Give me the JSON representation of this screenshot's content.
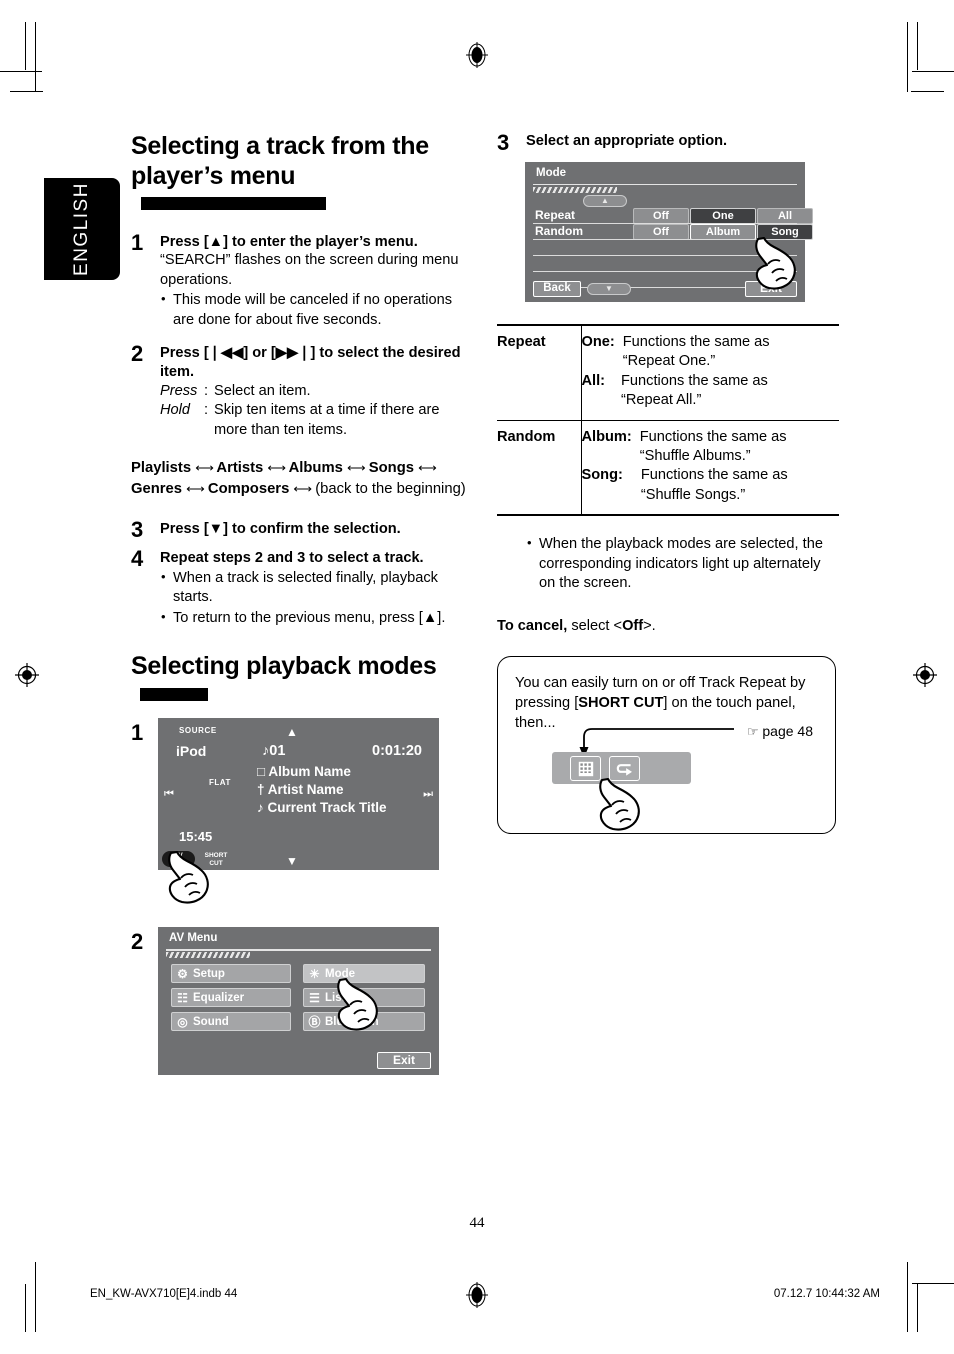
{
  "language_tab": "ENGLISH",
  "left_column": {
    "heading": "Selecting a track from the player’s menu",
    "steps": [
      {
        "num": "1",
        "lead": "Press [▲] to enter the player’s menu.",
        "body": "“SEARCH” flashes on the screen during menu operations.",
        "bullets": [
          "This mode will be canceled if no operations are done for about five seconds."
        ]
      },
      {
        "num": "2",
        "lead": "Press [❘◀◀] or [▶▶❘] to select the desired item.",
        "press_key": "Press",
        "press_val": "Select an item.",
        "hold_key": "Hold",
        "hold_val": "Skip ten items at a time if there are more than ten items."
      },
      {
        "num": "3",
        "lead": "Press [▼] to confirm the selection."
      },
      {
        "num": "4",
        "lead": "Repeat steps 2 and 3 to select a track.",
        "bullets": [
          "When a track is selected finally, playback starts.",
          "To return to the previous menu, press [▲]."
        ]
      }
    ],
    "chain": {
      "items": [
        "Playlists",
        "Artists",
        "Albums",
        "Songs",
        "Genres",
        "Composers"
      ],
      "tail": "(back to the beginning)",
      "arrow": "⟷"
    },
    "heading2": "Selecting playback modes",
    "step1_num": "1",
    "step2_num": "2"
  },
  "ipod_screen": {
    "source_label": "SOURCE",
    "source_name": "iPod",
    "track": "♪01",
    "time": "0:01:20",
    "album": "Album Name",
    "artist": "Artist Name",
    "title": "Current Track Title",
    "album_icon": "□",
    "artist_icon": "†",
    "title_icon": "♪",
    "flat": "FLAT",
    "prev_icon": "⏮",
    "next_icon": "⏭",
    "clock": "15:45",
    "up_arrow": "▲",
    "down_arrow": "▼",
    "av_menu_line1": "AV",
    "av_menu_line2": "MENU",
    "shortcut_line1": "SHORT",
    "shortcut_line2": "CUT"
  },
  "av_menu_screen": {
    "title": "AV Menu",
    "left_items": [
      {
        "label": "Setup",
        "icon": "⚙"
      },
      {
        "label": "Equalizer",
        "icon": "☷"
      },
      {
        "label": "Sound",
        "icon": "◎"
      }
    ],
    "right_items": [
      {
        "label": "Mode",
        "icon": "☀"
      },
      {
        "label": "List",
        "icon": "☰"
      },
      {
        "label": "Bluetooth",
        "icon": "Ⓑ"
      }
    ],
    "exit": "Exit"
  },
  "right_column": {
    "step3_num": "3",
    "step3_lead": "Select an appropriate option.",
    "note_bullet": "When the playback modes are selected, the corresponding indicators light up alternately on the screen.",
    "cancel_bold": "To cancel,",
    "cancel_rest": " select <Off>.",
    "cancel_off": "Off"
  },
  "mode_screen": {
    "title": "Mode",
    "rows": [
      {
        "label": "Repeat",
        "options": [
          {
            "text": "Off",
            "state": "plain"
          },
          {
            "text": "One",
            "state": "sel"
          },
          {
            "text": "All",
            "state": "plain"
          }
        ]
      },
      {
        "label": "Random",
        "options": [
          {
            "text": "Off",
            "state": "plain"
          },
          {
            "text": "Album",
            "state": "outline"
          },
          {
            "text": "Song",
            "state": "sel"
          }
        ]
      }
    ],
    "back": "Back",
    "exit": "Exit",
    "up_arrow": "▲",
    "down_arrow": "▼"
  },
  "spec_table": {
    "rows": [
      {
        "category": "Repeat",
        "defs": [
          {
            "key": "One:",
            "line1": "Functions the same as",
            "line2": "“Repeat One.”"
          },
          {
            "key": "All:",
            "line1": "Functions the same as",
            "line2": "“Repeat All.”"
          }
        ]
      },
      {
        "category": "Random",
        "defs": [
          {
            "key": "Album:",
            "line1": "Functions the same as",
            "line2": "“Shuffle Albums.”"
          },
          {
            "key": "Song:",
            "line1": "Functions the same as",
            "line2": "“Shuffle Songs.”"
          }
        ]
      }
    ]
  },
  "tip_box": {
    "text_pre": "You can easily turn on or off Track Repeat by pressing [",
    "text_bold": "SHORT CUT",
    "text_post": "] on the touch panel, then...",
    "page_ref": "page 48",
    "page_ref_icon": "☞",
    "button1_icon": "keypad-icon",
    "button2_icon": "↪"
  },
  "footer": {
    "page_number": "44",
    "file_name": "EN_KW-AVX710[E]4.indb   44",
    "timestamp": "07.12.7   10:44:32 AM"
  },
  "colors": {
    "screen_bg": "#6f7072",
    "screen_btn": "#a4a5a7",
    "screen_sel": "#3f4042",
    "black": "#000000",
    "white": "#ffffff"
  }
}
